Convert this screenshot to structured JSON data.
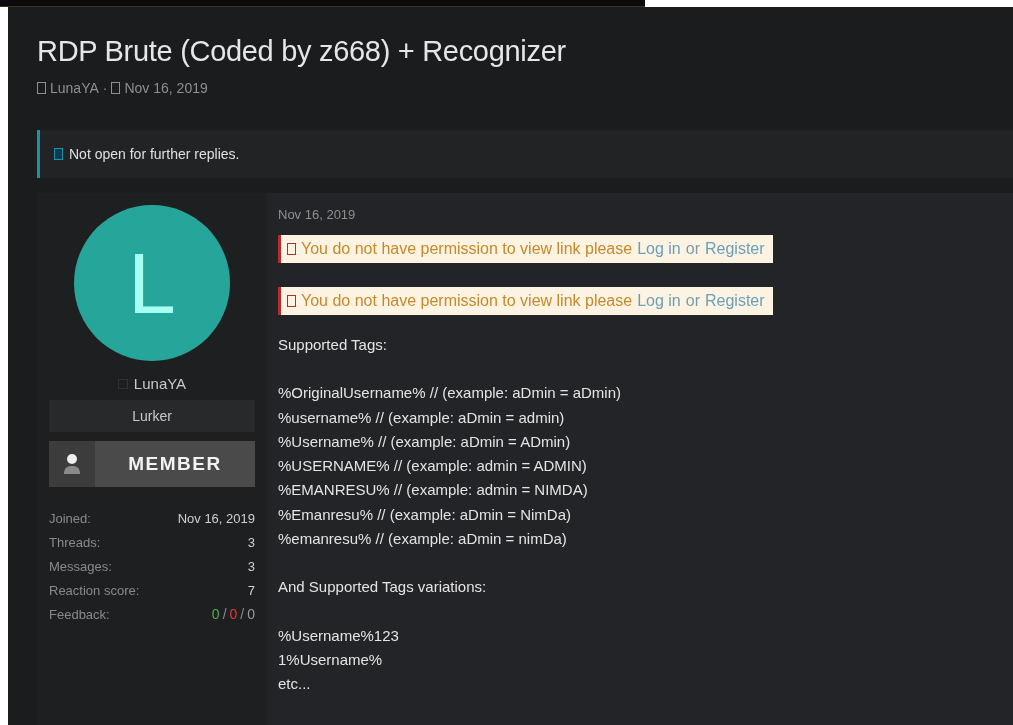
{
  "thread": {
    "title": "RDP Brute (Coded by z668) + Recognizer",
    "author": "LunaYA",
    "separator": "·",
    "date": "Nov 16, 2019"
  },
  "notice": "Not open for further replies.",
  "user": {
    "avatar_letter": "L",
    "name": "LunaYA",
    "title": "Lurker",
    "banner": "MEMBER",
    "stats": [
      {
        "label": "Joined:",
        "value": "Nov 16, 2019"
      },
      {
        "label": "Threads:",
        "value": "3"
      },
      {
        "label": "Messages:",
        "value": "3"
      },
      {
        "label": "Reaction score:",
        "value": "7"
      }
    ],
    "feedback": {
      "label": "Feedback:",
      "separator": "/",
      "counts": [
        {
          "text": "0",
          "color": "#4caf50"
        },
        {
          "text": "0",
          "color": "#e53935"
        },
        {
          "text": "0",
          "color": "#9a9a9a"
        }
      ]
    }
  },
  "post": {
    "date": "Nov 16, 2019",
    "alerts": [
      {
        "message": "You do not have permission to view link please",
        "login": "Log in",
        "or": "or",
        "register": "Register"
      },
      {
        "message": "You do not have permission to view link please",
        "login": "Log in",
        "or": "or",
        "register": "Register"
      }
    ],
    "paragraphs": [
      [
        "Supported Tags:"
      ],
      [
        "%OriginalUsername% // (example: aDmin = aDmin)",
        "%username% // (example: aDmin = admin)",
        "%Username% // (example: aDmin = ADmin)",
        "%USERNAME% // (example: admin = ADMIN)",
        "%EMANRESU% // (example: admin = NIMDA)",
        "%Emanresu% // (example: aDmin = NimDa)",
        "%emanresu% // (example: aDmin = nimDa)"
      ],
      [
        "And Supported Tags variations:"
      ],
      [
        "%Username%123",
        "1%Username%",
        "etc..."
      ]
    ]
  }
}
